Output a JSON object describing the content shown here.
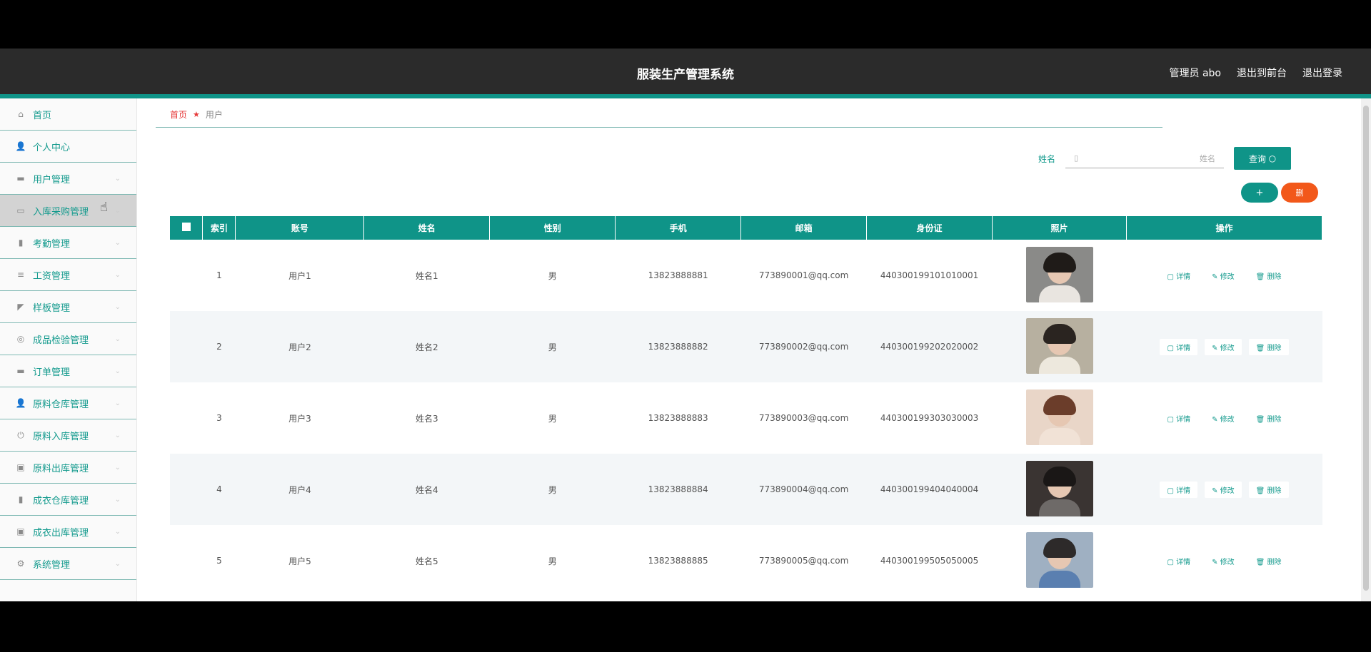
{
  "header": {
    "title": "服装生产管理系统",
    "admin": "管理员 abo",
    "to_front": "退出到前台",
    "logout": "退出登录"
  },
  "sidebar": {
    "items": [
      {
        "label": "首页",
        "icon": "home-icon",
        "glyph": "⌂"
      },
      {
        "label": "个人中心",
        "icon": "user-icon",
        "glyph": "👤"
      },
      {
        "label": "用户管理",
        "icon": "monitor-icon",
        "glyph": "▬"
      },
      {
        "label": "入库采购管理",
        "icon": "folder-icon",
        "glyph": "▭"
      },
      {
        "label": "考勤管理",
        "icon": "chat-icon",
        "glyph": "▮"
      },
      {
        "label": "工资管理",
        "icon": "list-icon",
        "glyph": "≡"
      },
      {
        "label": "样板管理",
        "icon": "megaphone-icon",
        "glyph": "◤"
      },
      {
        "label": "成品检验管理",
        "icon": "headset-icon",
        "glyph": "◎"
      },
      {
        "label": "订单管理",
        "icon": "monitor-icon",
        "glyph": "▬"
      },
      {
        "label": "原料仓库管理",
        "icon": "user-icon",
        "glyph": "👤"
      },
      {
        "label": "原料入库管理",
        "icon": "power-icon",
        "glyph": "⏻"
      },
      {
        "label": "原料出库管理",
        "icon": "box-icon",
        "glyph": "▣"
      },
      {
        "label": "成衣仓库管理",
        "icon": "bar-chart-icon",
        "glyph": "▮"
      },
      {
        "label": "成衣出库管理",
        "icon": "box-icon",
        "glyph": "▣"
      },
      {
        "label": "系统管理",
        "icon": "gear-icon",
        "glyph": "⚙"
      }
    ]
  },
  "breadcrumb": {
    "home": "首页",
    "current": "用户"
  },
  "search": {
    "label": "姓名",
    "placeholder": "姓名",
    "button": "查询"
  },
  "actions": {
    "add": "+",
    "delete": "删"
  },
  "table": {
    "headers": [
      "",
      "索引",
      "账号",
      "姓名",
      "性别",
      "手机",
      "邮箱",
      "身份证",
      "照片",
      "操作"
    ],
    "rows": [
      {
        "index": "1",
        "account": "用户1",
        "name": "姓名1",
        "gender": "男",
        "phone": "13823888881",
        "email": "773890001@qq.com",
        "id": "440300199101010001"
      },
      {
        "index": "2",
        "account": "用户2",
        "name": "姓名2",
        "gender": "男",
        "phone": "13823888882",
        "email": "773890002@qq.com",
        "id": "440300199202020002"
      },
      {
        "index": "3",
        "account": "用户3",
        "name": "姓名3",
        "gender": "男",
        "phone": "13823888883",
        "email": "773890003@qq.com",
        "id": "440300199303030003"
      },
      {
        "index": "4",
        "account": "用户4",
        "name": "姓名4",
        "gender": "男",
        "phone": "13823888884",
        "email": "773890004@qq.com",
        "id": "440300199404040004"
      },
      {
        "index": "5",
        "account": "用户5",
        "name": "姓名5",
        "gender": "男",
        "phone": "13823888885",
        "email": "773890005@qq.com",
        "id": "440300199505050005"
      }
    ],
    "ops": {
      "detail": "详情",
      "edit": "修改",
      "delete": "删除"
    }
  },
  "colors": {
    "accent": "#0f9488",
    "danger": "#f2581a",
    "topbar": "#2b2b2b"
  }
}
